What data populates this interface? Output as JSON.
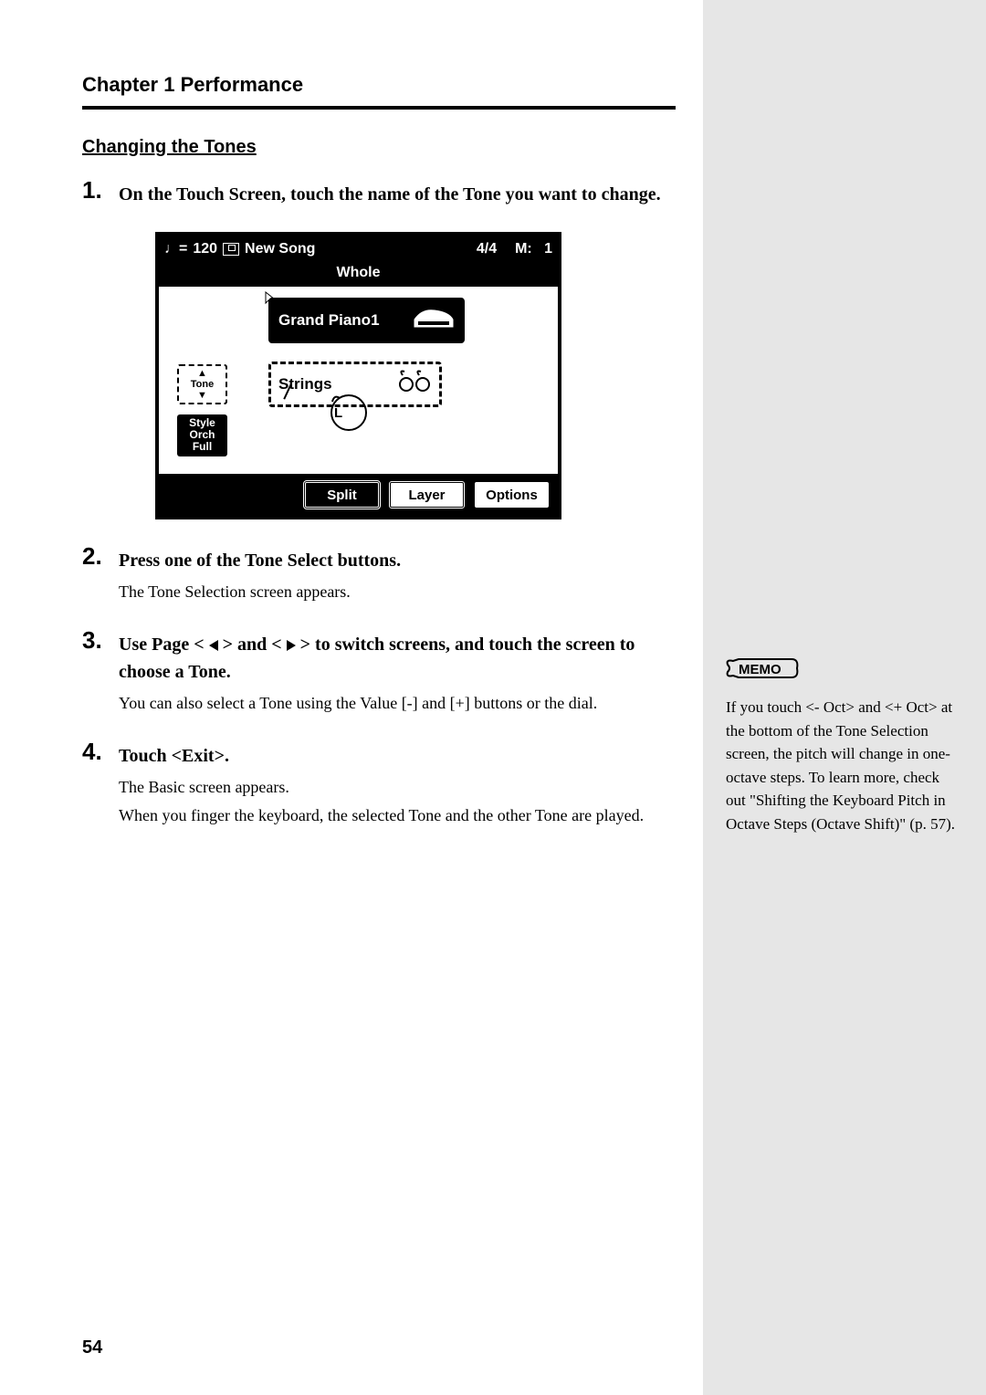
{
  "header": {
    "chapter": "Chapter 1 Performance"
  },
  "section": {
    "title": "Changing the Tones"
  },
  "steps": {
    "s1": {
      "num": "1",
      "lead": "On the Touch Screen, touch the name of the Tone you want to change."
    },
    "s2": {
      "num": "2",
      "lead": "Press one of the Tone Select buttons.",
      "sub1": "The Tone Selection screen appears."
    },
    "s3": {
      "num": "3",
      "lead_pre": "Use Page < ",
      "lead_mid": " > and < ",
      "lead_post": " > to switch screens, and touch the screen to choose a Tone.",
      "sub1": "You can also select a Tone using the Value [-] and [+] buttons or the dial."
    },
    "s4": {
      "num": "4",
      "lead": "Touch <Exit>.",
      "sub1": "The Basic screen appears.",
      "sub2": "When you finger the keyboard, the selected Tone and the other Tone are played."
    }
  },
  "device": {
    "tempo": "120",
    "song": "New Song",
    "timesig": "4/4",
    "measure_label": "M:",
    "measure": "1",
    "whole": "Whole",
    "tone1": "Grand Piano1",
    "tone2": "Strings",
    "tone_nav_up": "▲",
    "tone_nav_label": "Tone",
    "tone_nav_down": "▼",
    "style_l1": "Style",
    "style_l2": "Orch",
    "style_l3": "Full",
    "l_label": "L",
    "btn_split": "Split",
    "btn_layer": "Layer",
    "btn_options": "Options"
  },
  "memo": {
    "label": "MEMO",
    "text": "If you touch <- Oct> and <+ Oct> at the bottom of the Tone Selection screen, the pitch will change in one-octave steps. To learn more, check out \"Shifting the Keyboard Pitch in Octave Steps (Octave Shift)\" (p. 57)."
  },
  "page": "54"
}
